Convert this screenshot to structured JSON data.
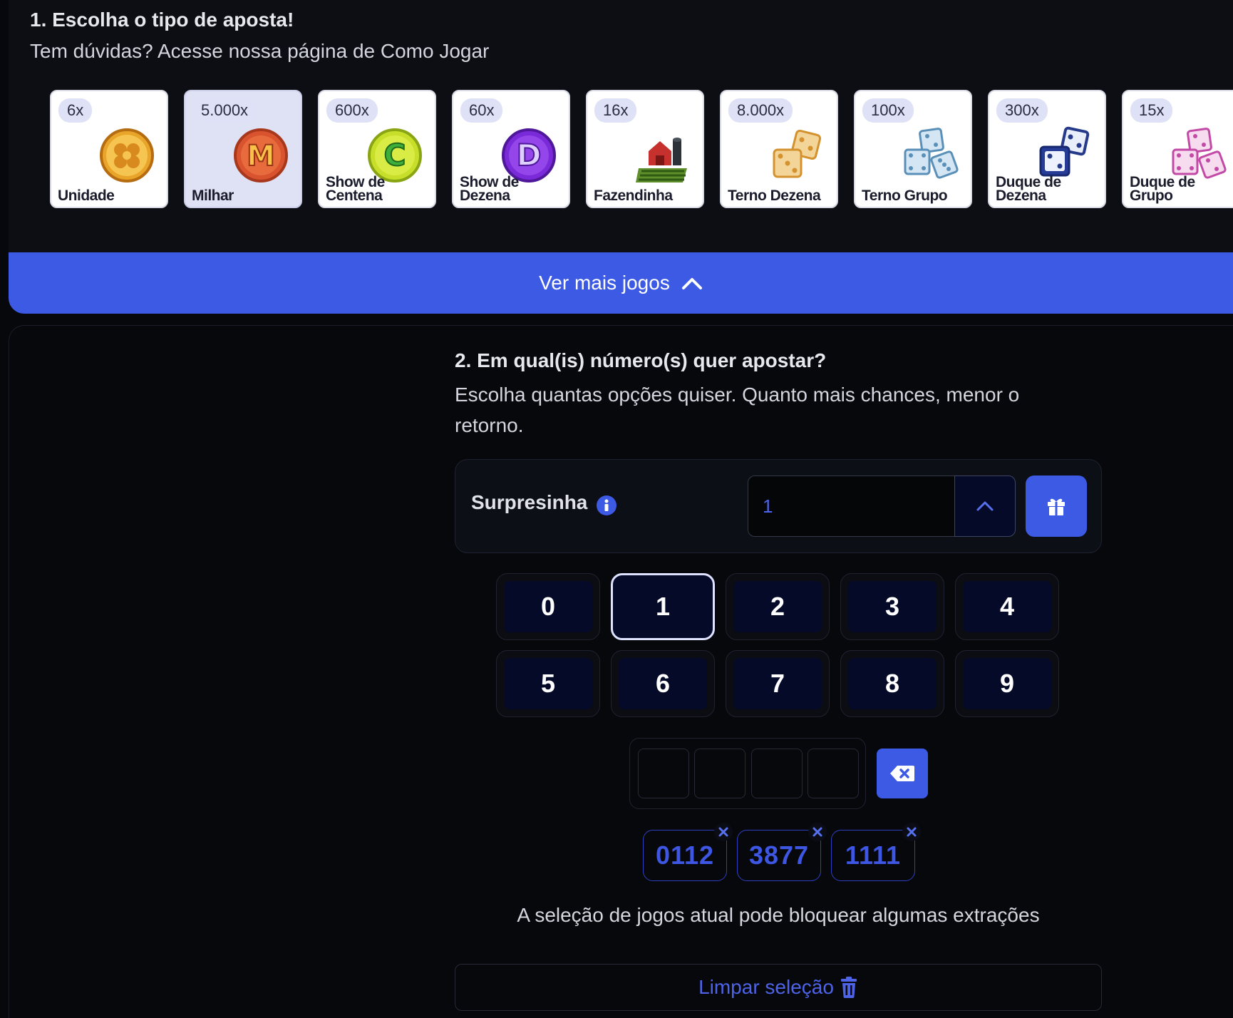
{
  "section1": {
    "title": "1. Escolha o tipo de aposta!",
    "subtitle": "Tem dúvidas? Acesse nossa página de Como Jogar"
  },
  "games": [
    {
      "multiplier": "6x",
      "name": "Unidade",
      "icon": "clover-coin-icon"
    },
    {
      "multiplier": "5.000x",
      "name": "Milhar",
      "icon": "letter-m-coin-icon",
      "selected": true
    },
    {
      "multiplier": "600x",
      "name": "Show de\nCentena",
      "icon": "letter-c-coin-icon"
    },
    {
      "multiplier": "60x",
      "name": "Show de\nDezena",
      "icon": "letter-d-coin-icon"
    },
    {
      "multiplier": "16x",
      "name": "Fazendinha",
      "icon": "farm-barn-icon"
    },
    {
      "multiplier": "8.000x",
      "name": "Terno Dezena",
      "icon": "orange-dice-icon"
    },
    {
      "multiplier": "100x",
      "name": "Terno Grupo",
      "icon": "blue-dice-icon"
    },
    {
      "multiplier": "300x",
      "name": "Duque de\nDezena",
      "icon": "dark-blue-dice-icon"
    },
    {
      "multiplier": "15x",
      "name": "Duque de\nGrupo",
      "icon": "pink-dice-icon"
    }
  ],
  "more_games": {
    "label": "Ver mais jogos",
    "icon": "chevron-up-icon"
  },
  "section2": {
    "title": "2. Em qual(is) número(s) quer apostar?",
    "subtitle": "Escolha quantas opções quiser. Quanto mais chances, menor o retorno."
  },
  "surpresinha": {
    "label": "Surpresinha",
    "value": "1",
    "info_icon": "info-icon",
    "step_icon": "chevron-up-icon",
    "gift_icon": "gift-icon"
  },
  "numpad": {
    "keys": [
      "0",
      "1",
      "2",
      "3",
      "4",
      "5",
      "6",
      "7",
      "8",
      "9"
    ],
    "active": "1"
  },
  "backspace_icon": "backspace-icon",
  "selections": [
    "0112",
    "3877",
    "1111"
  ],
  "warning": "A seleção de jogos atual pode bloquear algumas extrações",
  "clear": {
    "label": "Limpar seleção",
    "icon": "trash-icon"
  },
  "colors": {
    "accent": "#3d5ae5",
    "background": "#07080c",
    "panel": "#0c0e14",
    "key_fill": "#050a28",
    "chip_text": "#3d56e3"
  }
}
